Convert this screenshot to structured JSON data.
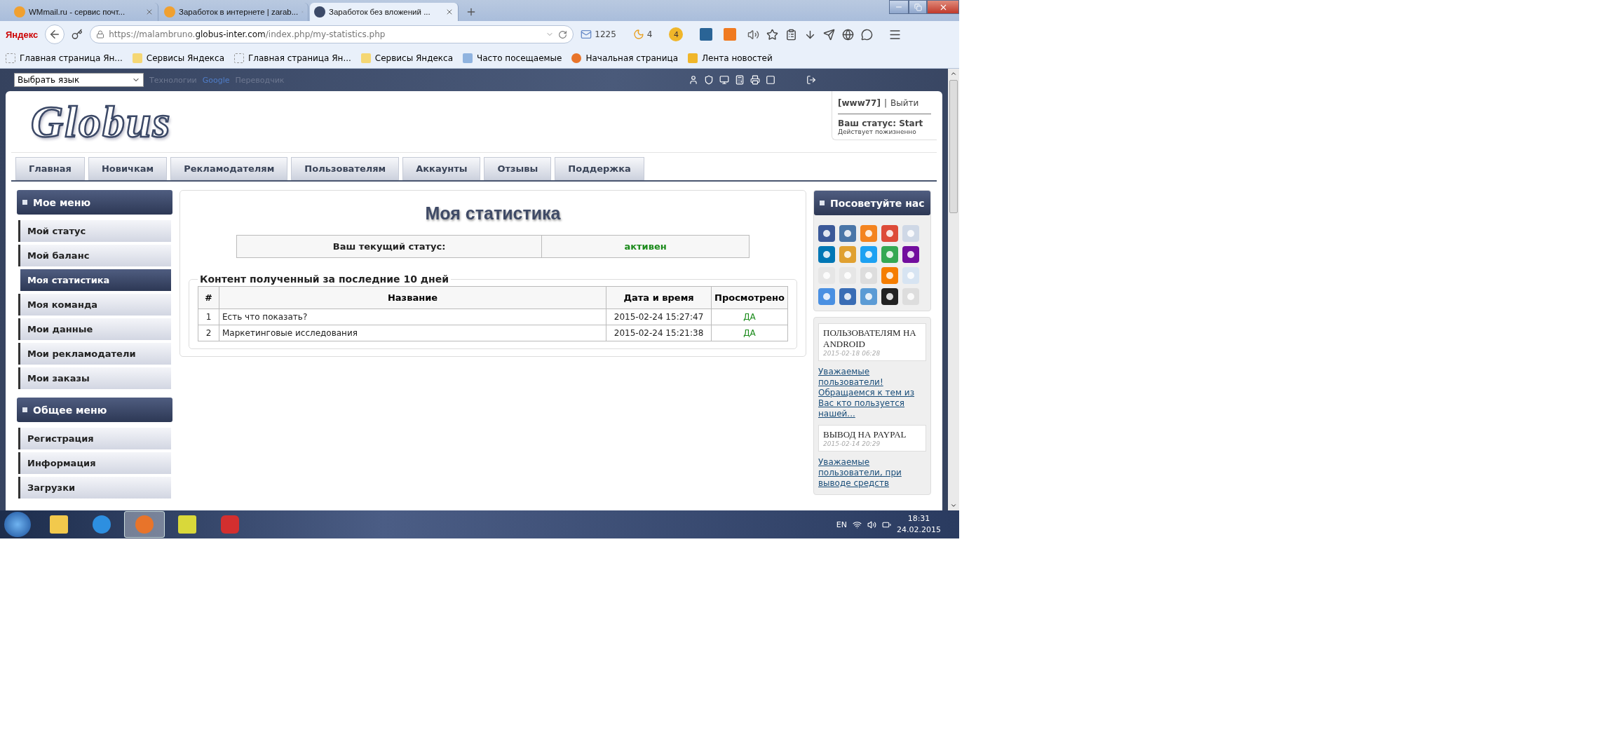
{
  "browser": {
    "tabs": [
      {
        "title": "WMmail.ru - сервис почт...",
        "selected": false
      },
      {
        "title": "Заработок в интернете | zarab...",
        "selected": false
      },
      {
        "title": "Заработок без вложений ...",
        "selected": true
      }
    ],
    "search_logo": "Яндекс",
    "url_parts": [
      {
        "text": "https://malambruno.",
        "emphasis": false
      },
      {
        "text": "globus-inter.com",
        "emphasis": true
      },
      {
        "text": "/index.php/my-statistics.php",
        "emphasis": false
      }
    ],
    "mail_count": "1225",
    "moon_count": "4",
    "badge_count": "4",
    "bookmarks": [
      {
        "label": "Главная страница Ян...",
        "kind": "blank"
      },
      {
        "label": "Сервисы Яндекса",
        "kind": "folder"
      },
      {
        "label": "Главная страница Ян...",
        "kind": "blank"
      },
      {
        "label": "Сервисы Яндекса",
        "kind": "folder"
      },
      {
        "label": "Часто посещаемые",
        "kind": "frequent"
      },
      {
        "label": "Начальная страница",
        "kind": "firefox"
      },
      {
        "label": "Лента новостей",
        "kind": "feed"
      }
    ]
  },
  "site": {
    "language_select": "Выбрать язык",
    "translate_credit": [
      "Технологии",
      "Google",
      "Переводчик"
    ],
    "logo": "Globus",
    "user": {
      "name": "[www77]",
      "separator": "|",
      "logout": "Выйти",
      "status": "Ваш статус: Start",
      "status_note": "Действует пожизненно"
    },
    "nav": [
      "Главная",
      "Новичкам",
      "Рекламодателям",
      "Пользователям",
      "Аккаунты",
      "Отзывы",
      "Поддержка"
    ],
    "menus": [
      {
        "title": "Мое меню",
        "items": [
          {
            "label": "Мой статус",
            "selected": false
          },
          {
            "label": "Мой баланс",
            "selected": false
          },
          {
            "label": "Моя статистика",
            "selected": true
          },
          {
            "label": "Моя команда",
            "selected": false
          },
          {
            "label": "Мои данные",
            "selected": false
          },
          {
            "label": "Мои рекламодатели",
            "selected": false
          },
          {
            "label": "Мои заказы",
            "selected": false
          }
        ]
      },
      {
        "title": "Общее меню",
        "items": [
          {
            "label": "Регистрация",
            "selected": false
          },
          {
            "label": "Информация",
            "selected": false
          },
          {
            "label": "Загрузки",
            "selected": false
          }
        ]
      }
    ],
    "content": {
      "title": "Моя статистика",
      "status_label": "Ваш текущий статус:",
      "status_value": "активен",
      "section_title": "Контент полученный за последние 10 дней",
      "columns": [
        "#",
        "Название",
        "Дата и время",
        "Просмотрено"
      ],
      "rows": [
        {
          "num": "1",
          "name": "Есть что показать?",
          "date": "2015-02-24 15:27:47",
          "viewed": "ДА"
        },
        {
          "num": "2",
          "name": "Маркетинговые исследования",
          "date": "2015-02-24 15:21:38",
          "viewed": "ДА"
        }
      ]
    },
    "share_title": "Посоветуйте нас",
    "news": [
      {
        "title": "ПОЛЬЗОВАТЕЛЯМ НА ANDROID",
        "date": "2015-02-18 06:28",
        "excerpt": "Уважаемые пользователи! Обращаемся к тем из Вас кто пользуется нашей..."
      },
      {
        "title": "ВЫВОД НА PAYPAL",
        "date": "2015-02-14 20:29",
        "excerpt": "Уважаемые пользователи, при выводе средств"
      }
    ]
  },
  "taskbar": {
    "apps": [
      {
        "kind": "explorer",
        "selected": false
      },
      {
        "kind": "ie",
        "selected": false
      },
      {
        "kind": "firefox",
        "selected": true
      },
      {
        "kind": "tank",
        "selected": false
      },
      {
        "kind": "opera",
        "selected": false
      }
    ],
    "language": "EN",
    "time": "18:31",
    "date": "24.02.2015"
  }
}
